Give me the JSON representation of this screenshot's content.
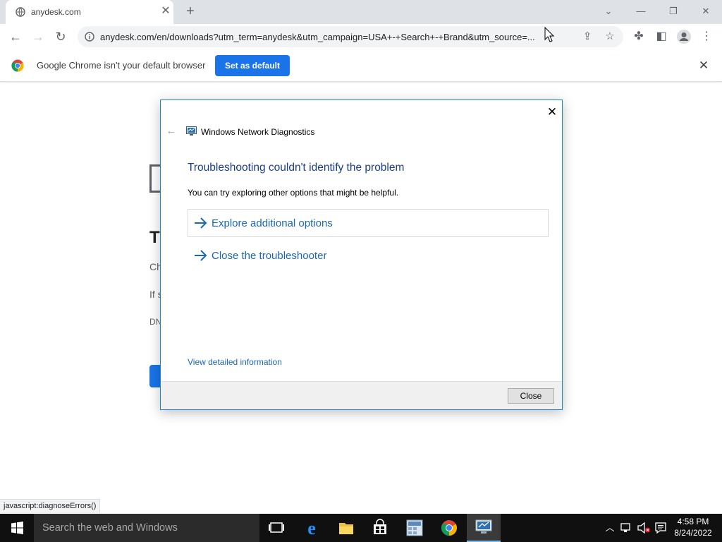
{
  "browser": {
    "tab": {
      "title": "anydesk.com"
    },
    "window_controls": {
      "tab_search": "⌄",
      "minimize": "—",
      "restore": "❐",
      "close": "✕"
    },
    "toolbar": {
      "url": "anydesk.com/en/downloads?utm_term=anydesk&utm_campaign=USA+-+Search+-+Brand&utm_source=..."
    },
    "infobar": {
      "message": "Google Chrome isn't your default browser",
      "button_label": "Set as default"
    },
    "status_bubble": "javascript:diagnoseErrors()"
  },
  "page_behind": {
    "title_partial": "T",
    "line1_partial": "Ch",
    "line2_partial": "If s",
    "line3_partial": "DN"
  },
  "dialog": {
    "app_title": "Windows Network Diagnostics",
    "heading": "Troubleshooting couldn't identify the problem",
    "subtext": "You can try exploring other options that might be helpful.",
    "options": [
      {
        "label": "Explore additional options"
      },
      {
        "label": "Close the troubleshooter"
      }
    ],
    "details_link": "View detailed information",
    "close_button": "Close"
  },
  "taskbar": {
    "search_placeholder": "Search the web and Windows",
    "apps": [
      "task-view",
      "edge",
      "file-explorer",
      "store",
      "calculator",
      "chrome",
      "network-diagnostics"
    ],
    "clock": {
      "time": "4:58 PM",
      "date": "8/24/2022"
    }
  },
  "colors": {
    "chrome_blue": "#1a73e8",
    "dialog_heading": "#1a3e8c",
    "dialog_link": "#1a67b5",
    "dialog_border": "#1883d7",
    "taskbar_bg": "#101010"
  }
}
